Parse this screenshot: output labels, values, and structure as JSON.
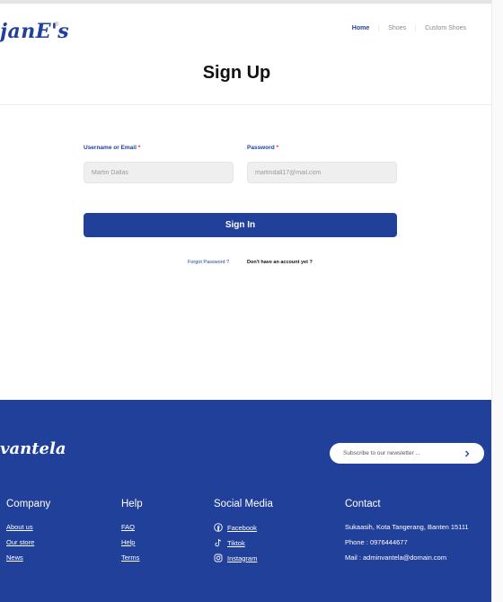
{
  "brand": {
    "logo_text": "janE's",
    "reg_mark": "®"
  },
  "nav": {
    "items": [
      "Home",
      "Shoes",
      "Custom Shoes"
    ]
  },
  "page_title": "Sign Up",
  "form": {
    "username_label": "Username or Email",
    "password_label": "Password",
    "required_mark": "*",
    "username_placeholder": "Martin Dallas",
    "password_placeholder": "martindall17@mail.com",
    "submit_label": "Sign In",
    "forgot_link": "Forgot Password ?",
    "no_account_link": "Don't have an account yet ?"
  },
  "footer": {
    "logo_text": "vantela",
    "newsletter_placeholder": "Subscribe to our newsletter ...",
    "company": {
      "heading": "Company",
      "links": [
        "About us",
        "Our store",
        "News"
      ]
    },
    "help": {
      "heading": "Help",
      "links": [
        "FAQ",
        "Help",
        "Terms"
      ]
    },
    "social": {
      "heading": "Social Media",
      "items": [
        {
          "label": "Facebook",
          "icon": "facebook-icon"
        },
        {
          "label": "Tiktok",
          "icon": "tiktok-icon"
        },
        {
          "label": "Instagram",
          "icon": "instagram-icon"
        }
      ]
    },
    "contact": {
      "heading": "Contact",
      "lines": [
        "Sukaasih, Kota Tangerang, Banten 15111",
        "Phone : 0976444677",
        "Mail : adminvantela@domain.com"
      ]
    }
  },
  "colors": {
    "accent": "#21409a",
    "required": "#e02b2b",
    "field_bg": "#efefef"
  }
}
